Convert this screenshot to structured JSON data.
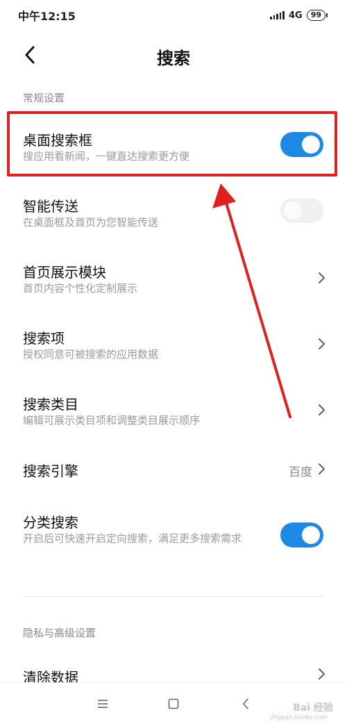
{
  "status_bar": {
    "time": "中午12:15",
    "network": "4G",
    "battery": "99"
  },
  "header": {
    "title": "搜索"
  },
  "sections": [
    {
      "title": "常规设置"
    },
    {
      "title": "隐私与高级设置"
    }
  ],
  "items": [
    {
      "title": "桌面搜索框",
      "subtitle": "搜应用看新闻，一键直达搜索更方便",
      "control": "toggle",
      "state": "on"
    },
    {
      "title": "智能传送",
      "subtitle": "在桌面框及首页为您智能传送",
      "control": "toggle",
      "state": "off"
    },
    {
      "title": "首页展示模块",
      "subtitle": "首页内容个性化定制展示",
      "control": "chevron"
    },
    {
      "title": "搜索项",
      "subtitle": "授权同意可被搜索的应用数据",
      "control": "chevron"
    },
    {
      "title": "搜索类目",
      "subtitle": "编辑可展示类目项和调整类目展示顺序",
      "control": "chevron"
    },
    {
      "title": "搜索引擎",
      "value": "百度",
      "control": "chevron"
    },
    {
      "title": "分类搜索",
      "subtitle": "开启后可快速开启定向搜索，满足更多搜索需求",
      "control": "toggle",
      "state": "on"
    },
    {
      "title": "清除数据",
      "control": "chevron"
    }
  ],
  "watermark": {
    "text": "Bai 经验",
    "sub": "jingyan.baidu.com"
  },
  "colors": {
    "accent": "#1e88e5",
    "highlight": "#e02020"
  }
}
